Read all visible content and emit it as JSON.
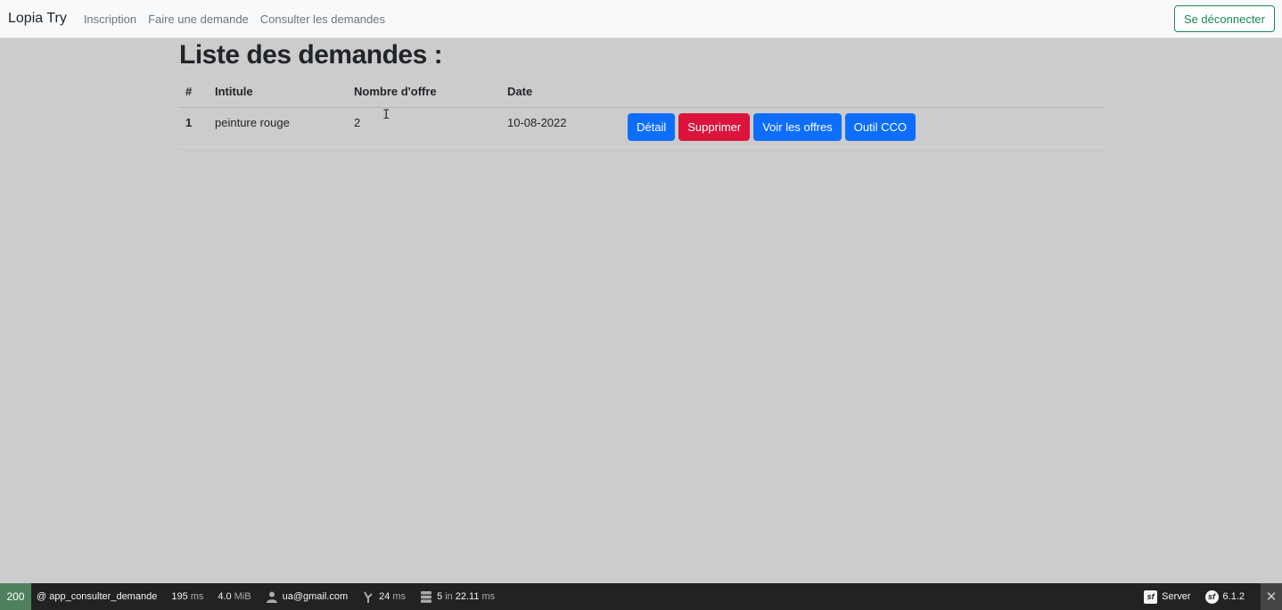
{
  "navbar": {
    "brand": "Lopia Try",
    "links": [
      "Inscription",
      "Faire une demande",
      "Consulter les demandes"
    ],
    "logout_label": "Se déconnecter"
  },
  "main": {
    "title": "Liste des demandes :",
    "table": {
      "headers": [
        "#",
        "Intitule",
        "Nombre d'offre",
        "Date"
      ],
      "rows": [
        {
          "id": "1",
          "intitule": "peinture rouge",
          "nombre_offre": "2",
          "date": "10-08-2022",
          "actions": [
            "Détail",
            "Supprimer",
            "Voir les offres",
            "Outil CCO"
          ]
        }
      ]
    }
  },
  "colors": {
    "primary": "#0d6efd",
    "danger": "#dc143c",
    "success": "#198754",
    "toolbar_bg": "#222222",
    "status_ok": "#4f805d"
  },
  "debug_toolbar": {
    "status_code": "200",
    "route": "@ app_consulter_demande",
    "time_value": "195",
    "time_unit": "ms",
    "memory_value": "4.0",
    "memory_unit": "MiB",
    "user": "ua@gmail.com",
    "twig_value": "24",
    "twig_unit": "ms",
    "db_queries": "5",
    "db_in": "in",
    "db_time": "22.11",
    "db_unit": "ms",
    "server_label": "Server",
    "version": "6.1.2",
    "icons": [
      "user-icon",
      "twig-icon",
      "database-icon",
      "symfony-icon",
      "close-icon"
    ]
  }
}
